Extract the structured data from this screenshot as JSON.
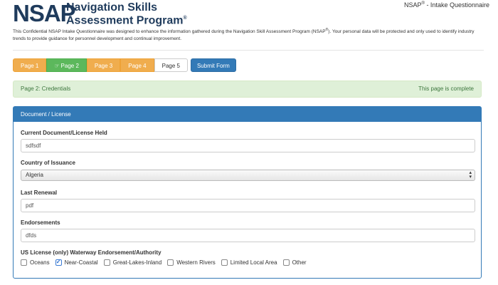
{
  "header": {
    "logo_text": "NSAP",
    "title_line1": "Navigation Skills",
    "title_line2": "Assessment Program",
    "reg_mark": "®",
    "top_right_prefix": "NSAP",
    "top_right_suffix": " - Intake Questionnaire"
  },
  "intro": {
    "text_before": "This Confidential NSAP Intake Questionnaire was designed to enhance the information gathered during the Navigation Skill Assessment Program (NSAP",
    "text_after": "). Your personal data will be protected and only used to identify industry trends to provide guidance for personnel development and continual improvement."
  },
  "pager": {
    "pages": [
      {
        "label": "Page 1",
        "style": "orange"
      },
      {
        "label": "Page 2",
        "style": "green",
        "icon": "thumbs-up-icon"
      },
      {
        "label": "Page 3",
        "style": "orange"
      },
      {
        "label": "Page 4",
        "style": "orange"
      },
      {
        "label": "Page 5",
        "style": "plain"
      }
    ],
    "submit_label": "Submit Form"
  },
  "alert": {
    "left": "Page 2: Credentials",
    "right": "This page is complete"
  },
  "panel": {
    "heading": "Document / License",
    "fields": [
      {
        "label": "Current Document/License Held",
        "value": "sdfsdf"
      },
      {
        "label": "Country of Issuance",
        "value": "Algeria"
      },
      {
        "label": "Last Renewal",
        "value": "pdf"
      },
      {
        "label": "Endorsements",
        "value": "dfds"
      }
    ],
    "waterway": {
      "label": "US License (only) Waterway Endorsement/Authority",
      "options": [
        {
          "label": "Oceans",
          "checked": false
        },
        {
          "label": "Near-Coastal",
          "checked": true
        },
        {
          "label": "Great-Lakes-Inland",
          "checked": false
        },
        {
          "label": "Western Rivers",
          "checked": false
        },
        {
          "label": "Limited Local Area",
          "checked": false
        },
        {
          "label": "Other",
          "checked": false
        }
      ]
    }
  },
  "colors": {
    "orange": "#f0ad4e",
    "green": "#5cb85c",
    "primary": "#337ab7",
    "success_bg": "#dff0d8",
    "success_text": "#3c763d",
    "logo": "#1f3b5c"
  }
}
